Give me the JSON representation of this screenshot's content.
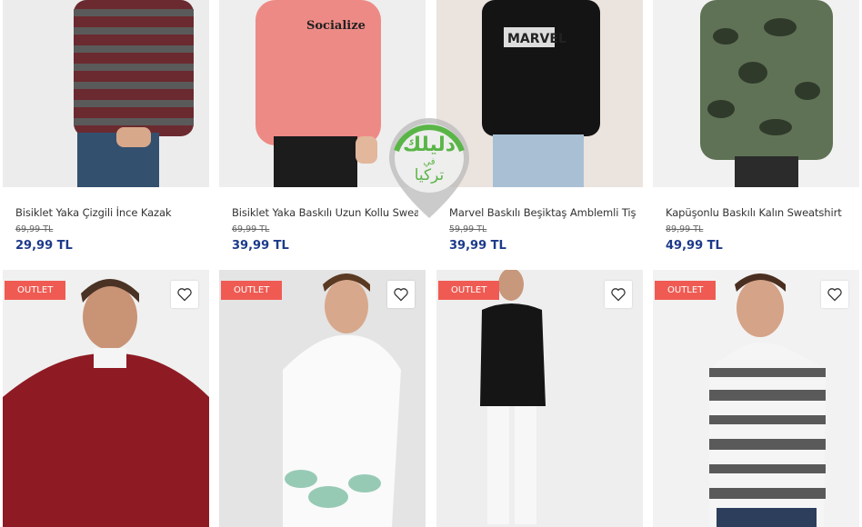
{
  "products_top": [
    {
      "name": "Bisiklet Yaka Çizgili İnce Kazak",
      "old_price": "69,99 TL",
      "price": "29,99 TL"
    },
    {
      "name": "Bisiklet Yaka Baskılı Uzun Kollu Swea...",
      "old_price": "69,99 TL",
      "price": "39,99 TL",
      "print": "Socialize"
    },
    {
      "name": "Marvel Baskılı Beşiktaş Amblemli Tiş...",
      "old_price": "59,99 TL",
      "price": "39,99 TL",
      "print": "MARVEL"
    },
    {
      "name": "Kapüşonlu Baskılı Kalın Sweatshirt",
      "old_price": "89,99 TL",
      "price": "49,99 TL"
    }
  ],
  "products_bottom": [
    {
      "badge": "OUTLET"
    },
    {
      "badge": "OUTLET"
    },
    {
      "badge": "OUTLET"
    },
    {
      "badge": "OUTLET"
    }
  ],
  "watermark": {
    "line1": "دليلك",
    "line2": "في",
    "line3": "تركيا"
  },
  "colors": {
    "price": "#1d3a8a",
    "badge": "#ef5b53",
    "watermark_green": "#5ab547"
  },
  "icons": {
    "favorite": "heart-icon"
  }
}
